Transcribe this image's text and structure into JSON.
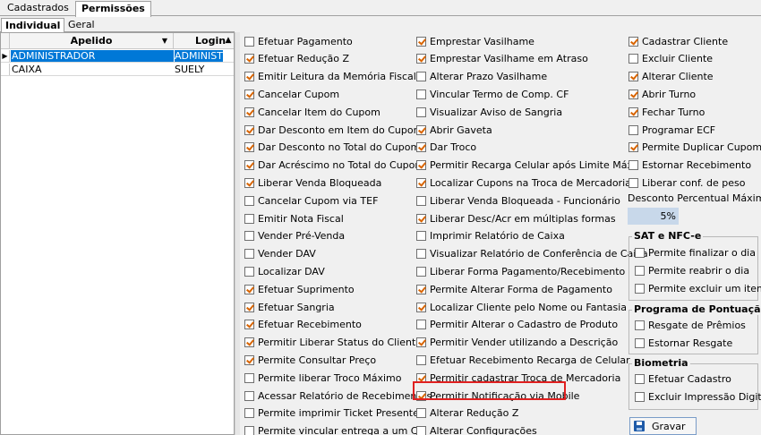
{
  "top_tabs": [
    "Cadastrados",
    "Permissões"
  ],
  "sub_tabs": [
    "Individual",
    "Geral"
  ],
  "grid": {
    "columns": [
      "Apelido",
      "Login"
    ],
    "rows": [
      {
        "apelido": "ADMINISTRADOR",
        "login": "ADMINISTR"
      },
      {
        "apelido": "CAIXA",
        "login": "SUELY"
      }
    ]
  },
  "col1": [
    {
      "label": "Efetuar Pagamento",
      "checked": false
    },
    {
      "label": "Efetuar Redução Z",
      "checked": true
    },
    {
      "label": "Emitir Leitura da Memória Fiscal",
      "checked": true
    },
    {
      "label": "Cancelar Cupom",
      "checked": true
    },
    {
      "label": "Cancelar Item do Cupom",
      "checked": true
    },
    {
      "label": "Dar Desconto em Item do Cupom",
      "checked": true
    },
    {
      "label": "Dar Desconto no Total do Cupom",
      "checked": true
    },
    {
      "label": "Dar Acréscimo no Total do Cupom",
      "checked": true
    },
    {
      "label": "Liberar Venda Bloqueada",
      "checked": true
    },
    {
      "label": "Cancelar Cupom via TEF",
      "checked": false
    },
    {
      "label": "Emitir Nota Fiscal",
      "checked": false
    },
    {
      "label": "Vender Pré-Venda",
      "checked": false
    },
    {
      "label": "Vender DAV",
      "checked": false
    },
    {
      "label": "Localizar DAV",
      "checked": false
    },
    {
      "label": "Efetuar Suprimento",
      "checked": true
    },
    {
      "label": "Efetuar Sangria",
      "checked": true
    },
    {
      "label": "Efetuar Recebimento",
      "checked": true
    },
    {
      "label": "Permitir Liberar Status do Cliente",
      "checked": true
    },
    {
      "label": "Permite Consultar Preço",
      "checked": true
    },
    {
      "label": "Permite liberar Troco Máximo",
      "checked": false
    },
    {
      "label": "Acessar Relatório de Recebimentos",
      "checked": false
    },
    {
      "label": "Permite imprimir Ticket Presente",
      "checked": false
    },
    {
      "label": "Permite vincular entrega a um CF",
      "checked": false
    }
  ],
  "col2": [
    {
      "label": "Emprestar Vasilhame",
      "checked": true
    },
    {
      "label": "Emprestar Vasilhame em Atraso",
      "checked": true
    },
    {
      "label": "Alterar Prazo Vasilhame",
      "checked": false
    },
    {
      "label": "Vincular Termo de Comp. CF",
      "checked": false
    },
    {
      "label": "Visualizar Aviso de Sangria",
      "checked": false
    },
    {
      "label": "Abrir Gaveta",
      "checked": true
    },
    {
      "label": "Dar Troco",
      "checked": true
    },
    {
      "label": "Permitir Recarga Celular após Limite Máx.",
      "checked": true
    },
    {
      "label": "Localizar Cupons na Troca de Mercadoria",
      "checked": true
    },
    {
      "label": "Liberar Venda Bloqueada - Funcionário",
      "checked": false
    },
    {
      "label": "Liberar Desc/Acr em múltiplas formas",
      "checked": true
    },
    {
      "label": "Imprimir Relatório de Caixa",
      "checked": false
    },
    {
      "label": "Visualizar Relatório de Conferência de Caixa",
      "checked": false
    },
    {
      "label": "Liberar Forma Pagamento/Recebimento",
      "checked": false
    },
    {
      "label": "Permite Alterar Forma de Pagamento",
      "checked": true
    },
    {
      "label": "Localizar Cliente pelo Nome ou Fantasia",
      "checked": true
    },
    {
      "label": "Permitir Alterar o Cadastro de Produto",
      "checked": false
    },
    {
      "label": "Permitir Vender utilizando a Descrição",
      "checked": true
    },
    {
      "label": "Efetuar Recebimento Recarga de Celular",
      "checked": false
    },
    {
      "label": "Permitir cadastrar Troca de Mercadoria",
      "checked": true
    },
    {
      "label": "Permitir Notificação via Mobile",
      "checked": true
    },
    {
      "label": "Alterar Redução Z",
      "checked": false
    },
    {
      "label": "Alterar Configurações",
      "checked": false
    }
  ],
  "col3": [
    {
      "label": "Cadastrar Cliente",
      "checked": true
    },
    {
      "label": "Excluir Cliente",
      "checked": false
    },
    {
      "label": "Alterar Cliente",
      "checked": true
    },
    {
      "label": "Abrir Turno",
      "checked": true
    },
    {
      "label": "Fechar Turno",
      "checked": true
    },
    {
      "label": "Programar ECF",
      "checked": false
    },
    {
      "label": "Permite Duplicar Cupom",
      "checked": true
    },
    {
      "label": "Estornar Recebimento",
      "checked": false
    },
    {
      "label": "Liberar conf. de peso",
      "checked": false
    }
  ],
  "desconto": {
    "label": "Desconto Percentual Máximo:",
    "value": "5%"
  },
  "sat_group": {
    "title": "SAT e NFC-e",
    "items": [
      {
        "label": "Permite finalizar o dia",
        "checked": false
      },
      {
        "label": "Permite reabrir o dia",
        "checked": false
      },
      {
        "label": "Permite excluir um item",
        "checked": false
      }
    ]
  },
  "pontuacao_group": {
    "title": "Programa de Pontuação",
    "items": [
      {
        "label": "Resgate de Prêmios",
        "checked": false
      },
      {
        "label": "Estornar Resgate",
        "checked": false
      }
    ]
  },
  "biometria_group": {
    "title": "Biometria",
    "items": [
      {
        "label": "Efetuar Cadastro",
        "checked": false
      },
      {
        "label": "Excluir Impressão Digital",
        "checked": false
      }
    ]
  },
  "save_button": "Gravar",
  "colors": {
    "selection": "#0078d7",
    "highlight": "#e02020",
    "check": "#d86400"
  }
}
